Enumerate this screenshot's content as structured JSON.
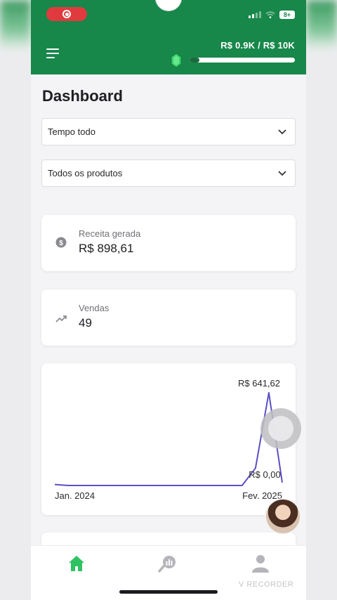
{
  "colors": {
    "header_bg": "#17874a",
    "accent_green": "#2fc262",
    "chart_line": "#5b4fc4",
    "progress_fill": "#1c6a3b"
  },
  "status_bar": {
    "battery": "8+"
  },
  "header": {
    "goal_text": "R$ 0.9K / R$ 10K",
    "goal_progress": 0.09
  },
  "page": {
    "title": "Dashboard"
  },
  "filters": {
    "period": {
      "selected": "Tempo todo"
    },
    "product": {
      "selected": "Todos os produtos"
    }
  },
  "stats": {
    "revenue": {
      "label": "Receita gerada",
      "value": "R$ 898,61",
      "icon": "dollar-circle-icon"
    },
    "sales": {
      "label": "Vendas",
      "value": "49",
      "icon": "trending-up-icon"
    }
  },
  "chart_data": {
    "type": "line",
    "x_start_label": "Jan. 2024",
    "x_end_label": "Fev. 2025",
    "max_label": "R$ 641,62",
    "min_label": "R$ 0,00",
    "values": [
      7,
      0,
      0,
      0,
      0,
      0,
      0,
      0,
      0,
      0,
      0,
      0,
      0,
      0,
      0,
      120,
      641.62,
      20
    ],
    "ylim": [
      0,
      641.62
    ]
  },
  "tabbar": {
    "items": [
      {
        "icon": "home-icon",
        "active": true
      },
      {
        "icon": "analytics-icon",
        "active": false
      },
      {
        "icon": "profile-icon",
        "active": false
      }
    ]
  },
  "overlay": {
    "watermark": "V RECORDER"
  }
}
